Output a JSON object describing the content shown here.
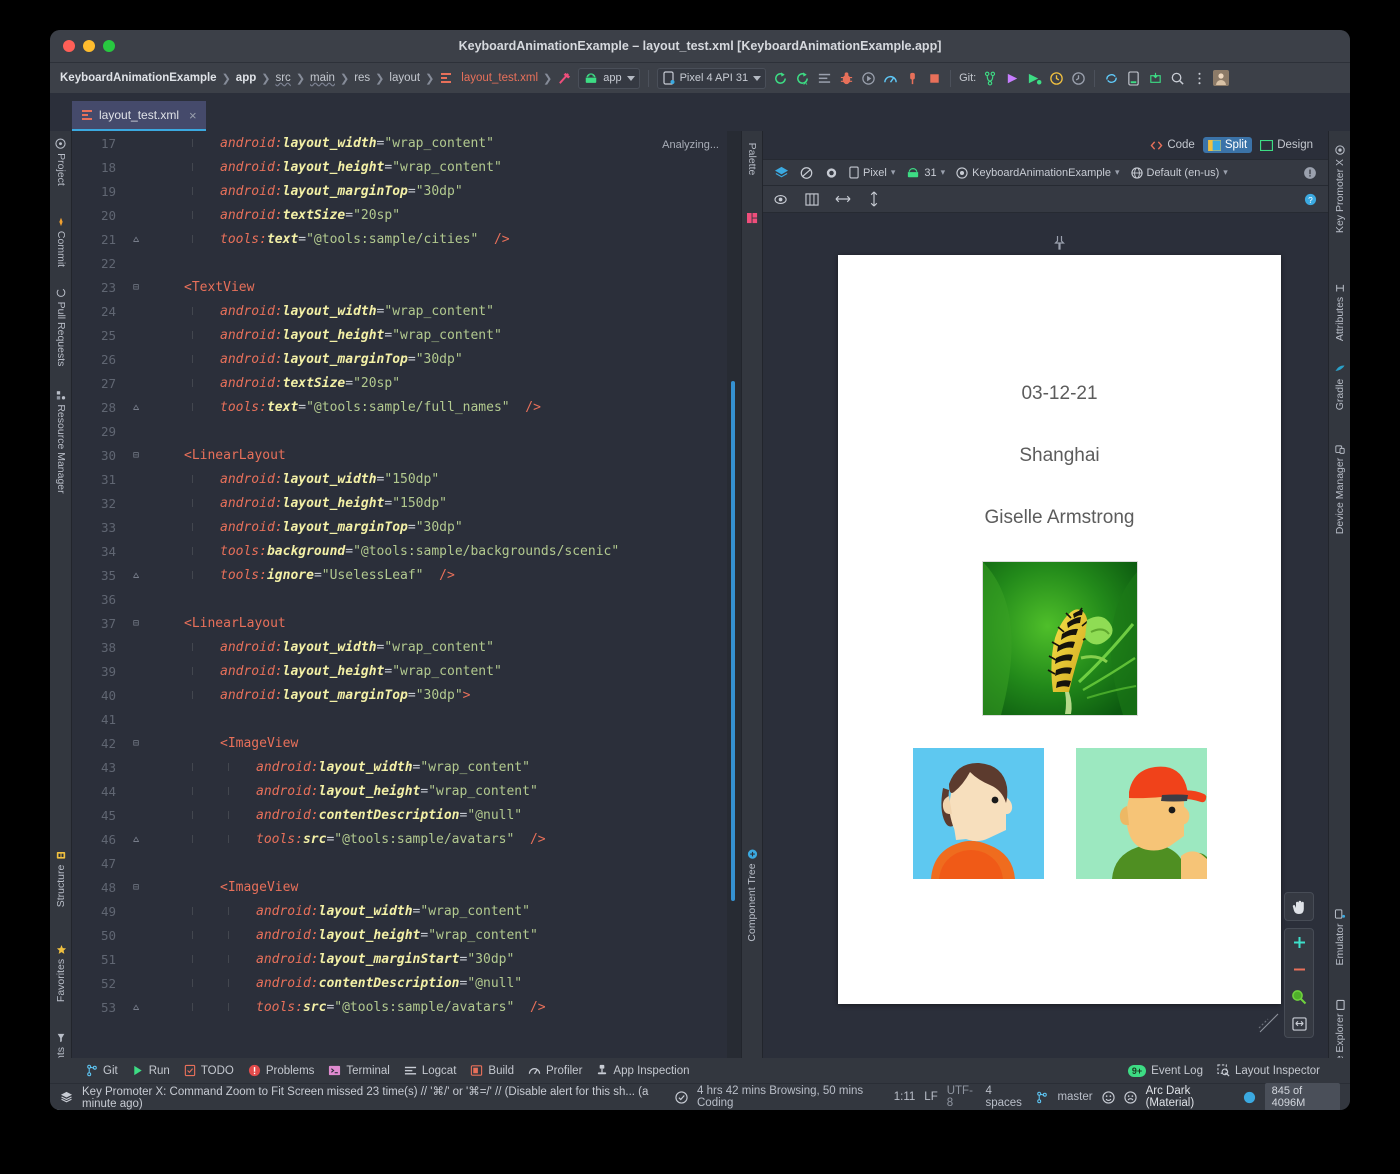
{
  "window": {
    "title": "KeyboardAnimationExample – layout_test.xml [KeyboardAnimationExample.app]"
  },
  "breadcrumbs": [
    {
      "label": "KeyboardAnimationExample",
      "style": "bold"
    },
    {
      "label": "app",
      "style": "bold"
    },
    {
      "label": "src",
      "style": "underline"
    },
    {
      "label": "main",
      "style": "underline"
    },
    {
      "label": "res",
      "style": "plain"
    },
    {
      "label": "layout",
      "style": "plain"
    },
    {
      "label": "layout_test.xml",
      "style": "file"
    }
  ],
  "toolbar": {
    "module_label": "app",
    "device_label": "Pixel 4 API 31",
    "git_label": "Git:"
  },
  "tabs": [
    {
      "label": "layout_test.xml",
      "close": "×"
    }
  ],
  "editor": {
    "analyzing_label": "Analyzing...",
    "lines": [
      {
        "num": "17",
        "indent": 2,
        "guide": true,
        "fold": "",
        "tokens": [
          {
            "t": "attr",
            "v": "android:"
          },
          {
            "t": "attr2",
            "v": "layout_width"
          },
          {
            "t": "eq",
            "v": "="
          },
          {
            "t": "str",
            "v": "\"wrap_content\""
          }
        ]
      },
      {
        "num": "18",
        "indent": 2,
        "guide": true,
        "fold": "",
        "tokens": [
          {
            "t": "attr",
            "v": "android:"
          },
          {
            "t": "attr2",
            "v": "layout_height"
          },
          {
            "t": "eq",
            "v": "="
          },
          {
            "t": "str",
            "v": "\"wrap_content\""
          }
        ]
      },
      {
        "num": "19",
        "indent": 2,
        "guide": true,
        "fold": "",
        "tokens": [
          {
            "t": "attr",
            "v": "android:"
          },
          {
            "t": "attr2",
            "v": "layout_marginTop"
          },
          {
            "t": "eq",
            "v": "="
          },
          {
            "t": "str",
            "v": "\"30dp\""
          }
        ]
      },
      {
        "num": "20",
        "indent": 2,
        "guide": true,
        "fold": "",
        "tokens": [
          {
            "t": "attr",
            "v": "android:"
          },
          {
            "t": "attr2",
            "v": "textSize"
          },
          {
            "t": "eq",
            "v": "="
          },
          {
            "t": "str",
            "v": "\"20sp\""
          }
        ]
      },
      {
        "num": "21",
        "indent": 2,
        "guide": true,
        "fold": "end",
        "tokens": [
          {
            "t": "attr",
            "v": "tools:"
          },
          {
            "t": "attr2",
            "v": "text"
          },
          {
            "t": "eq",
            "v": "="
          },
          {
            "t": "str",
            "v": "\"@tools:sample/cities\""
          },
          {
            "t": "close",
            "v": "  />"
          }
        ]
      },
      {
        "num": "22",
        "indent": 0,
        "guide": false,
        "fold": "",
        "tokens": []
      },
      {
        "num": "23",
        "indent": 1,
        "guide": false,
        "fold": "open",
        "tokens": [
          {
            "t": "tag",
            "v": "<TextView"
          }
        ]
      },
      {
        "num": "24",
        "indent": 2,
        "guide": true,
        "fold": "",
        "tokens": [
          {
            "t": "attr",
            "v": "android:"
          },
          {
            "t": "attr2",
            "v": "layout_width"
          },
          {
            "t": "eq",
            "v": "="
          },
          {
            "t": "str",
            "v": "\"wrap_content\""
          }
        ]
      },
      {
        "num": "25",
        "indent": 2,
        "guide": true,
        "fold": "",
        "tokens": [
          {
            "t": "attr",
            "v": "android:"
          },
          {
            "t": "attr2",
            "v": "layout_height"
          },
          {
            "t": "eq",
            "v": "="
          },
          {
            "t": "str",
            "v": "\"wrap_content\""
          }
        ]
      },
      {
        "num": "26",
        "indent": 2,
        "guide": true,
        "fold": "",
        "tokens": [
          {
            "t": "attr",
            "v": "android:"
          },
          {
            "t": "attr2",
            "v": "layout_marginTop"
          },
          {
            "t": "eq",
            "v": "="
          },
          {
            "t": "str",
            "v": "\"30dp\""
          }
        ]
      },
      {
        "num": "27",
        "indent": 2,
        "guide": true,
        "fold": "",
        "tokens": [
          {
            "t": "attr",
            "v": "android:"
          },
          {
            "t": "attr2",
            "v": "textSize"
          },
          {
            "t": "eq",
            "v": "="
          },
          {
            "t": "str",
            "v": "\"20sp\""
          }
        ]
      },
      {
        "num": "28",
        "indent": 2,
        "guide": true,
        "fold": "end",
        "tokens": [
          {
            "t": "attr",
            "v": "tools:"
          },
          {
            "t": "attr2",
            "v": "text"
          },
          {
            "t": "eq",
            "v": "="
          },
          {
            "t": "str",
            "v": "\"@tools:sample/full_names\""
          },
          {
            "t": "close",
            "v": "  />"
          }
        ]
      },
      {
        "num": "29",
        "indent": 0,
        "guide": false,
        "fold": "",
        "tokens": []
      },
      {
        "num": "30",
        "indent": 1,
        "guide": false,
        "fold": "open",
        "tokens": [
          {
            "t": "tag",
            "v": "<LinearLayout"
          }
        ]
      },
      {
        "num": "31",
        "indent": 2,
        "guide": true,
        "fold": "",
        "tokens": [
          {
            "t": "attr",
            "v": "android:"
          },
          {
            "t": "attr2",
            "v": "layout_width"
          },
          {
            "t": "eq",
            "v": "="
          },
          {
            "t": "str",
            "v": "\"150dp\""
          }
        ]
      },
      {
        "num": "32",
        "indent": 2,
        "guide": true,
        "fold": "",
        "tokens": [
          {
            "t": "attr",
            "v": "android:"
          },
          {
            "t": "attr2",
            "v": "layout_height"
          },
          {
            "t": "eq",
            "v": "="
          },
          {
            "t": "str",
            "v": "\"150dp\""
          }
        ]
      },
      {
        "num": "33",
        "indent": 2,
        "guide": true,
        "fold": "",
        "tokens": [
          {
            "t": "attr",
            "v": "android:"
          },
          {
            "t": "attr2",
            "v": "layout_marginTop"
          },
          {
            "t": "eq",
            "v": "="
          },
          {
            "t": "str",
            "v": "\"30dp\""
          }
        ]
      },
      {
        "num": "34",
        "indent": 2,
        "guide": true,
        "fold": "",
        "tokens": [
          {
            "t": "attr",
            "v": "tools:"
          },
          {
            "t": "attr2",
            "v": "background"
          },
          {
            "t": "eq",
            "v": "="
          },
          {
            "t": "str",
            "v": "\"@tools:sample/backgrounds/scenic\""
          }
        ]
      },
      {
        "num": "35",
        "indent": 2,
        "guide": true,
        "fold": "end",
        "tokens": [
          {
            "t": "attr",
            "v": "tools:"
          },
          {
            "t": "attr2",
            "v": "ignore"
          },
          {
            "t": "eq",
            "v": "="
          },
          {
            "t": "str",
            "v": "\"UselessLeaf\""
          },
          {
            "t": "close",
            "v": "  />"
          }
        ]
      },
      {
        "num": "36",
        "indent": 0,
        "guide": false,
        "fold": "",
        "tokens": []
      },
      {
        "num": "37",
        "indent": 1,
        "guide": false,
        "fold": "open",
        "tokens": [
          {
            "t": "tag",
            "v": "<LinearLayout"
          }
        ]
      },
      {
        "num": "38",
        "indent": 2,
        "guide": true,
        "fold": "",
        "tokens": [
          {
            "t": "attr",
            "v": "android:"
          },
          {
            "t": "attr2",
            "v": "layout_width"
          },
          {
            "t": "eq",
            "v": "="
          },
          {
            "t": "str",
            "v": "\"wrap_content\""
          }
        ]
      },
      {
        "num": "39",
        "indent": 2,
        "guide": true,
        "fold": "",
        "tokens": [
          {
            "t": "attr",
            "v": "android:"
          },
          {
            "t": "attr2",
            "v": "layout_height"
          },
          {
            "t": "eq",
            "v": "="
          },
          {
            "t": "str",
            "v": "\"wrap_content\""
          }
        ]
      },
      {
        "num": "40",
        "indent": 2,
        "guide": true,
        "fold": "",
        "tokens": [
          {
            "t": "attr",
            "v": "android:"
          },
          {
            "t": "attr2",
            "v": "layout_marginTop"
          },
          {
            "t": "eq",
            "v": "="
          },
          {
            "t": "str",
            "v": "\"30dp\""
          },
          {
            "t": "close",
            "v": ">"
          }
        ]
      },
      {
        "num": "41",
        "indent": 0,
        "guide": false,
        "fold": "",
        "tokens": []
      },
      {
        "num": "42",
        "indent": 2,
        "guide": false,
        "fold": "open",
        "tokens": [
          {
            "t": "tag",
            "v": "<ImageView"
          }
        ]
      },
      {
        "num": "43",
        "indent": 3,
        "guide": true,
        "fold": "",
        "tokens": [
          {
            "t": "attr",
            "v": "android:"
          },
          {
            "t": "attr2",
            "v": "layout_width"
          },
          {
            "t": "eq",
            "v": "="
          },
          {
            "t": "str",
            "v": "\"wrap_content\""
          }
        ]
      },
      {
        "num": "44",
        "indent": 3,
        "guide": true,
        "fold": "",
        "tokens": [
          {
            "t": "attr",
            "v": "android:"
          },
          {
            "t": "attr2",
            "v": "layout_height"
          },
          {
            "t": "eq",
            "v": "="
          },
          {
            "t": "str",
            "v": "\"wrap_content\""
          }
        ]
      },
      {
        "num": "45",
        "indent": 3,
        "guide": true,
        "fold": "",
        "tokens": [
          {
            "t": "attr",
            "v": "android:"
          },
          {
            "t": "attr2",
            "v": "contentDescription"
          },
          {
            "t": "eq",
            "v": "="
          },
          {
            "t": "str",
            "v": "\"@null\""
          }
        ]
      },
      {
        "num": "46",
        "indent": 3,
        "guide": true,
        "fold": "end",
        "tokens": [
          {
            "t": "attr",
            "v": "tools:"
          },
          {
            "t": "attr2",
            "v": "src"
          },
          {
            "t": "eq",
            "v": "="
          },
          {
            "t": "str",
            "v": "\"@tools:sample/avatars\""
          },
          {
            "t": "close",
            "v": "  />"
          }
        ]
      },
      {
        "num": "47",
        "indent": 0,
        "guide": false,
        "fold": "",
        "tokens": []
      },
      {
        "num": "48",
        "indent": 2,
        "guide": false,
        "fold": "open",
        "tokens": [
          {
            "t": "tag",
            "v": "<ImageView"
          }
        ]
      },
      {
        "num": "49",
        "indent": 3,
        "guide": true,
        "fold": "",
        "tokens": [
          {
            "t": "attr",
            "v": "android:"
          },
          {
            "t": "attr2",
            "v": "layout_width"
          },
          {
            "t": "eq",
            "v": "="
          },
          {
            "t": "str",
            "v": "\"wrap_content\""
          }
        ]
      },
      {
        "num": "50",
        "indent": 3,
        "guide": true,
        "fold": "",
        "tokens": [
          {
            "t": "attr",
            "v": "android:"
          },
          {
            "t": "attr2",
            "v": "layout_height"
          },
          {
            "t": "eq",
            "v": "="
          },
          {
            "t": "str",
            "v": "\"wrap_content\""
          }
        ]
      },
      {
        "num": "51",
        "indent": 3,
        "guide": true,
        "fold": "",
        "tokens": [
          {
            "t": "attr",
            "v": "android:"
          },
          {
            "t": "attr2",
            "v": "layout_marginStart"
          },
          {
            "t": "eq",
            "v": "="
          },
          {
            "t": "str",
            "v": "\"30dp\""
          }
        ]
      },
      {
        "num": "52",
        "indent": 3,
        "guide": true,
        "fold": "",
        "tokens": [
          {
            "t": "attr",
            "v": "android:"
          },
          {
            "t": "attr2",
            "v": "contentDescription"
          },
          {
            "t": "eq",
            "v": "="
          },
          {
            "t": "str",
            "v": "\"@null\""
          }
        ]
      },
      {
        "num": "53",
        "indent": 3,
        "guide": true,
        "fold": "end",
        "tokens": [
          {
            "t": "attr",
            "v": "tools:"
          },
          {
            "t": "attr2",
            "v": "src"
          },
          {
            "t": "eq",
            "v": "="
          },
          {
            "t": "str",
            "v": "\"@tools:sample/avatars\""
          },
          {
            "t": "close",
            "v": "  />"
          }
        ]
      }
    ]
  },
  "left_tool_window": {
    "top": [
      "Project",
      "Commit",
      "Pull Requests",
      "Resource Manager"
    ],
    "bottom": [
      "Structure",
      "Favorites",
      "Build Variants"
    ]
  },
  "right_tool_window": {
    "top": [
      "Key Promoter X",
      "Attributes",
      "Gradle",
      "Device Manager"
    ],
    "bottom": [
      "Emulator",
      "Device File Explorer"
    ]
  },
  "design": {
    "palette_label": "Palette",
    "component_tree_label": "Component Tree",
    "modes": [
      {
        "label": "Code",
        "active": false
      },
      {
        "label": "Split",
        "active": true
      },
      {
        "label": "Design",
        "active": false
      }
    ],
    "device_label": "Pixel",
    "api_label": "31",
    "theme_label": "KeyboardAnimationExample",
    "locale_label": "Default (en-us)"
  },
  "preview": {
    "date_text": "03-12-21",
    "city_text": "Shanghai",
    "name_text": "Giselle Armstrong"
  },
  "footer": {
    "tools": [
      {
        "label": "Git",
        "icon": "git-branch-icon"
      },
      {
        "label": "Run",
        "icon": "run-icon"
      },
      {
        "label": "TODO",
        "icon": "todo-icon"
      },
      {
        "label": "Problems",
        "icon": "problems-icon"
      },
      {
        "label": "Terminal",
        "icon": "terminal-icon"
      },
      {
        "label": "Logcat",
        "icon": "logcat-icon"
      },
      {
        "label": "Build",
        "icon": "build-icon"
      },
      {
        "label": "Profiler",
        "icon": "profiler-icon"
      },
      {
        "label": "App Inspection",
        "icon": "app-inspection-icon"
      }
    ],
    "event_log_label": "Event Log",
    "event_log_badge": "9+",
    "layout_inspector_label": "Layout Inspector",
    "status_message": "Key Promoter X: Command Zoom to Fit Screen missed 23 time(s) // '⌘/' or '⌘=/' // (Disable alert for this sh... (a minute ago)",
    "wakatime": "4 hrs 42 mins Browsing, 50 mins Coding",
    "caret_position": "1:11",
    "line_separator": "LF",
    "encoding": "UTF-8",
    "indent": "4 spaces",
    "branch": "master",
    "theme_name": "Arc Dark (Material)",
    "memory": "845 of 4096M"
  },
  "colors": {
    "accent_blue": "#3ba9e0",
    "tag_red": "#e8705a",
    "string_green": "#b2c98f",
    "attr_yellow": "#f3f0a6",
    "active_tab_blue": "#3b73a8"
  }
}
